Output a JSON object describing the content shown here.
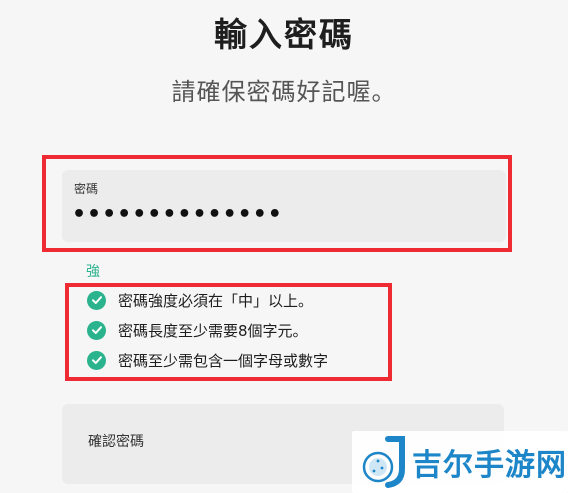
{
  "header": {
    "title": "輸入密碼",
    "subtitle": "請確保密碼好記喔。"
  },
  "password_field": {
    "label": "密碼",
    "value": "••••••••••••••"
  },
  "strength": {
    "label": "強",
    "color": "#2ab38d"
  },
  "rules": [
    {
      "text": "密碼強度必須在「中」以上。",
      "icon": "check-circle-icon",
      "met": true
    },
    {
      "text": "密碼長度至少需要8個字元。",
      "icon": "check-circle-icon",
      "met": true
    },
    {
      "text": "密碼至少需包含一個字母或數字",
      "icon": "check-circle-icon",
      "met": true
    }
  ],
  "confirm_field": {
    "label": "確認密碼"
  },
  "watermark": {
    "text": "吉尔手游网",
    "icon": "watermark-logo-icon"
  },
  "colors": {
    "highlight_border": "#ee2b33",
    "check_green": "#2ab38d"
  }
}
